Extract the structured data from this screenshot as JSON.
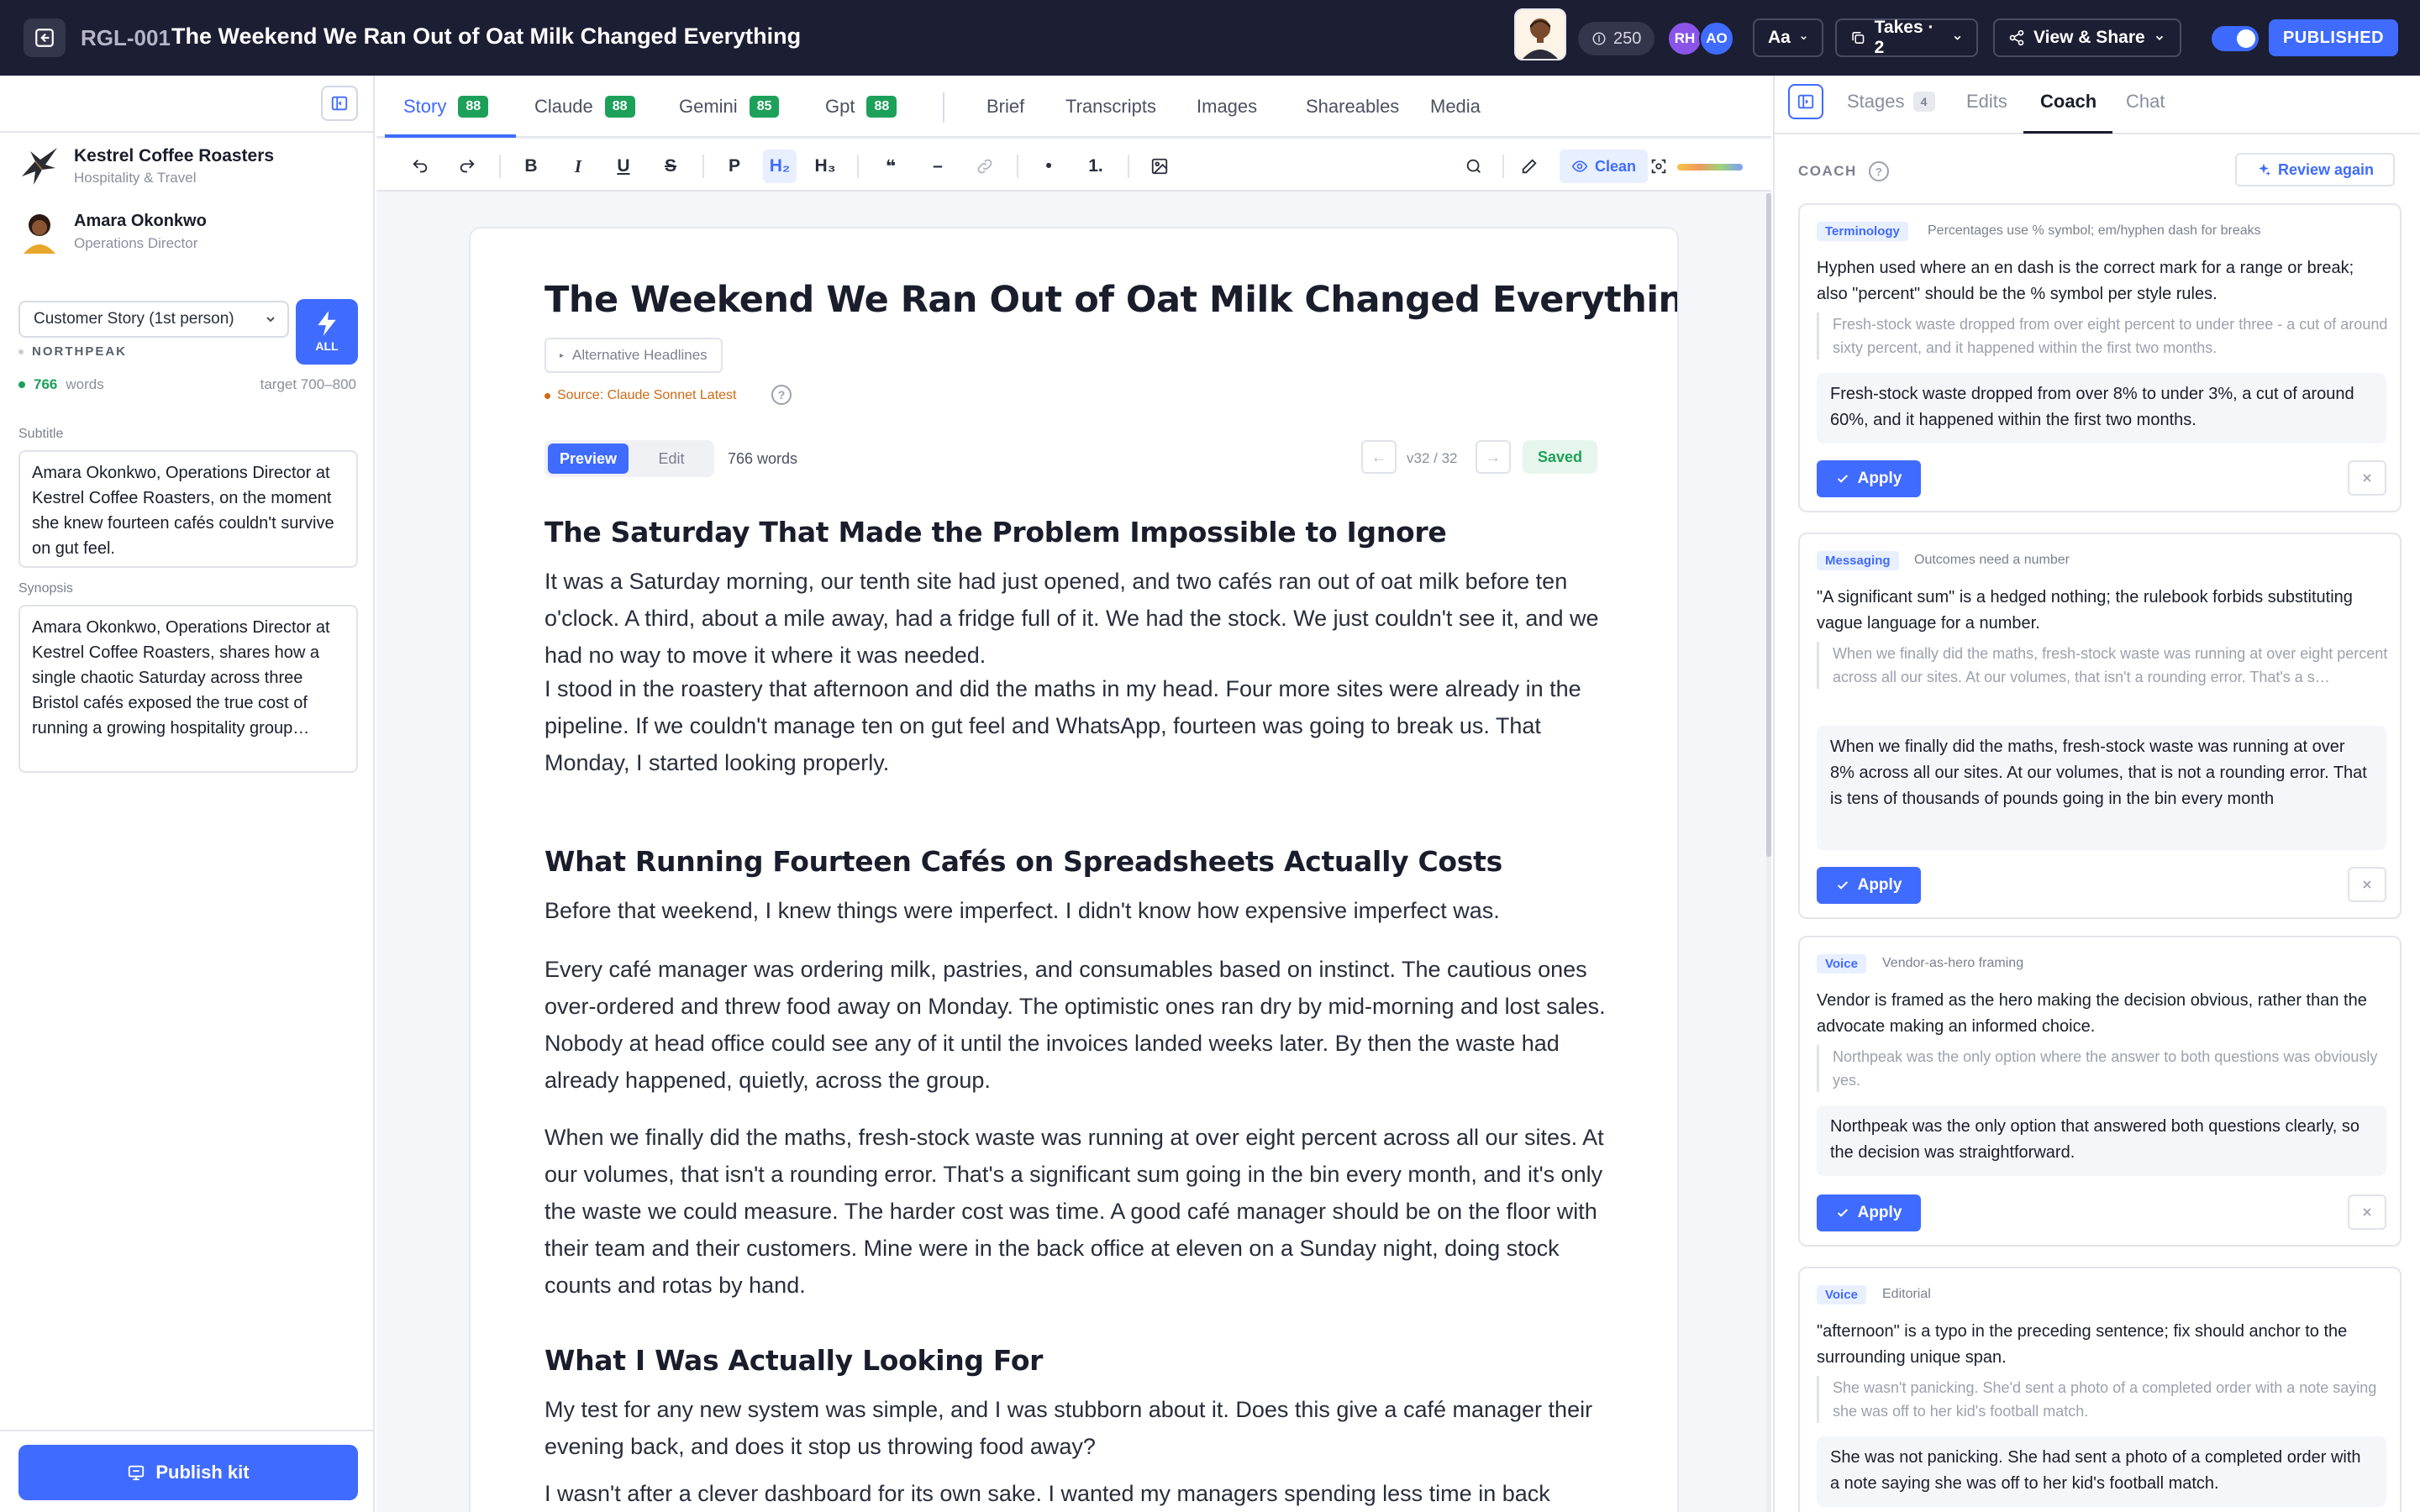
{
  "topbar": {
    "doc_id": "RGL-001",
    "title": "The Weekend We Ran Out of Oat Milk Changed Everything",
    "credits": "250",
    "collaborators": [
      {
        "initials": "RH",
        "color": "#8a54e8"
      },
      {
        "initials": "AO",
        "color": "#3f6bff"
      }
    ],
    "font_button": "Aa",
    "takes_button": "Takes · 2",
    "view_share_button": "View & Share",
    "published_label": "PUBLISHED"
  },
  "sidebar": {
    "org_name": "Kestrel Coffee Roasters",
    "org_industry": "Hospitality & Travel",
    "person_name": "Amara Okonkwo",
    "person_role": "Operations Director",
    "story_type": "Customer Story (1st person)",
    "all_label": "ALL",
    "vendor": "NORTHPEAK",
    "word_count": "766",
    "words_label": "words",
    "target": "target 700–800",
    "subtitle_label": "Subtitle",
    "subtitle": "Amara Okonkwo, Operations Director at Kestrel Coffee Roasters, on the moment she knew fourteen cafés couldn't survive on gut feel.",
    "synopsis_label": "Synopsis",
    "synopsis": "Amara Okonkwo, Operations Director at Kestrel Coffee Roasters, shares how a single chaotic Saturday across three Bristol cafés exposed the true cost of running a growing hospitality group…",
    "publish_kit": "Publish kit"
  },
  "tabs": [
    {
      "label": "Story",
      "score": "88"
    },
    {
      "label": "Claude",
      "score": "88"
    },
    {
      "label": "Gemini",
      "score": "85"
    },
    {
      "label": "Gpt",
      "score": "88"
    }
  ],
  "tabs_secondary": [
    "Brief",
    "Transcripts",
    "Images",
    "Shareables",
    "Media"
  ],
  "toolbar": {
    "clean_label": "Clean",
    "bold": "B",
    "italic": "I",
    "underline": "U",
    "strike": "S",
    "paragraph": "P",
    "h2": "H₂",
    "h3": "H₃",
    "quote": "❝",
    "dash": "–",
    "bullet": "•",
    "numbered": "1."
  },
  "document": {
    "title": "The Weekend We Ran Out of Oat Milk Changed Everything",
    "alt_headlines": "Alternative Headlines",
    "source": "Source: Claude Sonnet Latest",
    "mode_preview": "Preview",
    "mode_edit": "Edit",
    "word_count": "766 words",
    "version": "v32 / 32",
    "saved": "Saved",
    "headings": [
      "The Saturday That Made the Problem Impossible to Ignore",
      "What Running Fourteen Cafés on Spreadsheets Actually Costs",
      "What I Was Actually Looking For"
    ],
    "paragraphs": [
      "It was a Saturday morning, our tenth site had just opened, and two cafés ran out of oat milk before ten o'clock. A third, about a mile away, had a fridge full of it. We had the stock. We just couldn't see it, and we had no way to move it where it was needed.",
      "I stood in the roastery that afternoon and did the maths in my head. Four more sites were already in the pipeline. If we couldn't manage ten on gut feel and WhatsApp, fourteen was going to break us. That Monday, I started looking properly.",
      "Before that weekend, I knew things were imperfect. I didn't know how expensive imperfect was.",
      "Every café manager was ordering milk, pastries, and consumables based on instinct. The cautious ones over-ordered and threw food away on Monday. The optimistic ones ran dry by mid-morning and lost sales. Nobody at head office could see any of it until the invoices landed weeks later. By then the waste had already happened, quietly, across the group.",
      "When we finally did the maths, fresh-stock waste was running at over eight percent across all our sites. At our volumes, that isn't a rounding error. That's a significant sum going in the bin every month, and it's only the waste we could measure. The harder cost was time. A good café manager should be on the floor with their team and their customers. Mine were in the back office at eleven on a Sunday night, doing stock counts and rotas by hand.",
      "My test for any new system was simple, and I was stubborn about it. Does this give a café manager their evening back, and does it stop us throwing food away?",
      "I wasn't after a clever dashboard for its own sake. I wanted my managers spending less time in back"
    ]
  },
  "coach": {
    "tabs": [
      {
        "label": "Stages",
        "count": "4"
      },
      {
        "label": "Edits"
      },
      {
        "label": "Coach"
      },
      {
        "label": "Chat"
      }
    ],
    "section_label": "COACH",
    "review_again": "Review again",
    "apply_label": "Apply",
    "cards": [
      {
        "tag": "Terminology",
        "rule": "Percentages use % symbol; em/hyphen dash for breaks",
        "description": "Hyphen used where an en dash is the correct mark for a range or break; also \"percent\" should be the % symbol per style rules.",
        "original": "Fresh-stock waste dropped from over eight percent to under three - a cut of around sixty percent, and it happened within the first two months.",
        "suggestion": "Fresh-stock waste dropped from over 8% to under 3%, a cut of around 60%, and it happened within the first two months."
      },
      {
        "tag": "Messaging",
        "rule": "Outcomes need a number",
        "description": "\"A significant sum\" is a hedged nothing; the rulebook forbids substituting vague language for a number.",
        "original": "When we finally did the maths, fresh-stock waste was running at over eight percent across all our sites. At our volumes, that isn't a rounding error. That's a s…",
        "suggestion": "When we finally did the maths, fresh-stock waste was running at over 8% across all our sites. At our volumes, that is not a rounding error. That is tens of thousands of pounds going in the bin every month"
      },
      {
        "tag": "Voice",
        "rule": "Vendor-as-hero framing",
        "description": "Vendor is framed as the hero making the decision obvious, rather than the advocate making an informed choice.",
        "original": "Northpeak was the only option where the answer to both questions was obviously yes.",
        "suggestion": "Northpeak was the only option that answered both questions clearly, so the decision was straightforward."
      },
      {
        "tag": "Voice",
        "rule": "Editorial",
        "description": "\"afternoon\" is a typo in the preceding sentence; fix should anchor to the surrounding unique span.",
        "original": "She wasn't panicking. She'd sent a photo of a completed order with a note saying she was off to her kid's football match.",
        "suggestion": "She was not panicking. She had sent a photo of a completed order with a note saying she was off to her kid's football match."
      }
    ]
  }
}
